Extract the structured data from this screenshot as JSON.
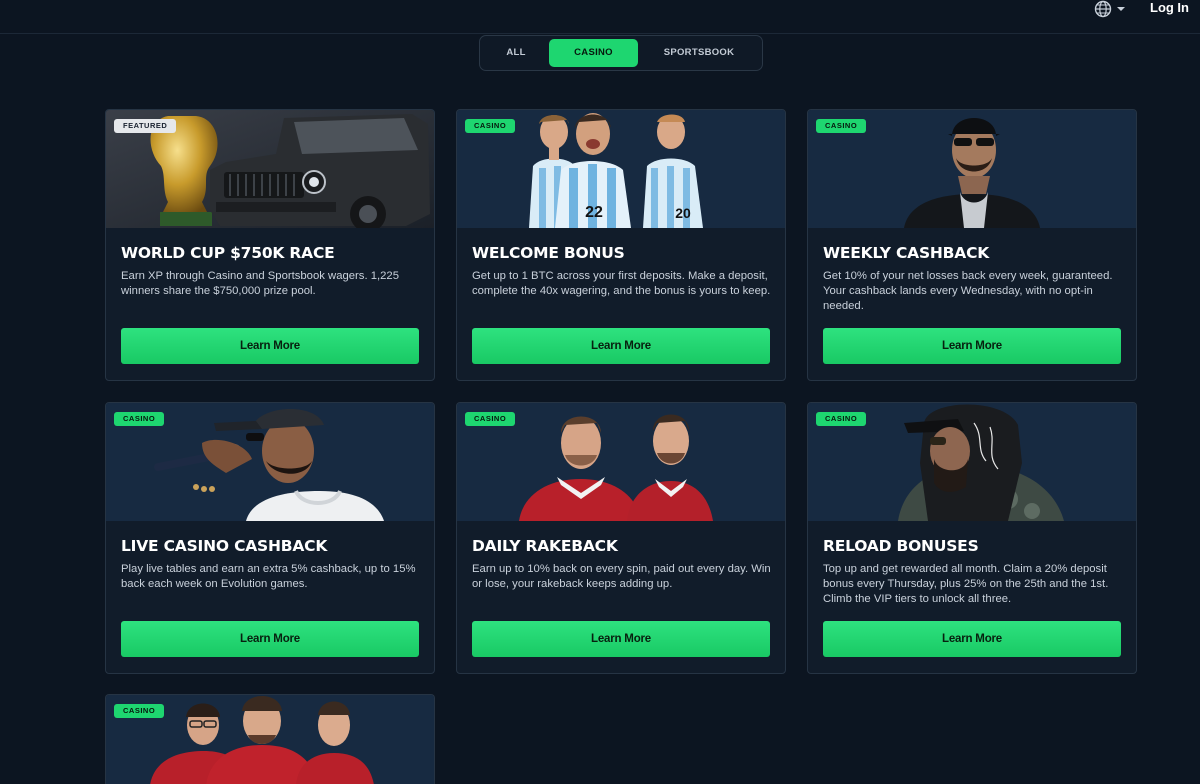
{
  "header": {
    "login_label": "Log In",
    "language_icon": "globe-icon"
  },
  "tabs": [
    {
      "label": "ALL",
      "active": false
    },
    {
      "label": "CASINO",
      "active": true
    },
    {
      "label": "SPORTSBOOK",
      "active": false
    }
  ],
  "colors": {
    "accent": "#1ed670",
    "background": "#0c1521",
    "card": "#111c2a"
  },
  "cards": [
    {
      "badge": "FEATURED",
      "title": "WORLD CUP $750K RACE",
      "description": "Earn XP through Casino and Sportsbook wagers. 1,225 winners share the $750,000 prize pool.",
      "button": "Learn More"
    },
    {
      "badge": "CASINO",
      "title": "WELCOME BONUS",
      "description": "Get up to 1 BTC across your first deposits. Make a deposit, complete the 40x wagering, and the bonus is yours to keep.",
      "button": "Learn More"
    },
    {
      "badge": "CASINO",
      "title": "WEEKLY CASHBACK",
      "description": "Get 10% of your net losses back every week, guaranteed. Your cashback lands every Wednesday, with no opt-in needed.",
      "button": "Learn More"
    },
    {
      "badge": "CASINO",
      "title": "LIVE CASINO CASHBACK",
      "description": "Play live tables and earn an extra 5% cashback, up to 15% back each week on Evolution games.",
      "button": "Learn More"
    },
    {
      "badge": "CASINO",
      "title": "DAILY RAKEBACK",
      "description": "Earn up to 10% back on every spin, paid out every day. Win or lose, your rakeback keeps adding up.",
      "button": "Learn More"
    },
    {
      "badge": "CASINO",
      "title": "RELOAD BONUSES",
      "description": "Top up and get rewarded all month. Claim a 20% deposit bonus every Thursday, plus 25% on the 25th and the 1st. Climb the VIP tiers to unlock all three.",
      "button": "Learn More"
    },
    {
      "badge": "CASINO"
    }
  ],
  "jersey_numbers": [
    "22",
    "20"
  ]
}
